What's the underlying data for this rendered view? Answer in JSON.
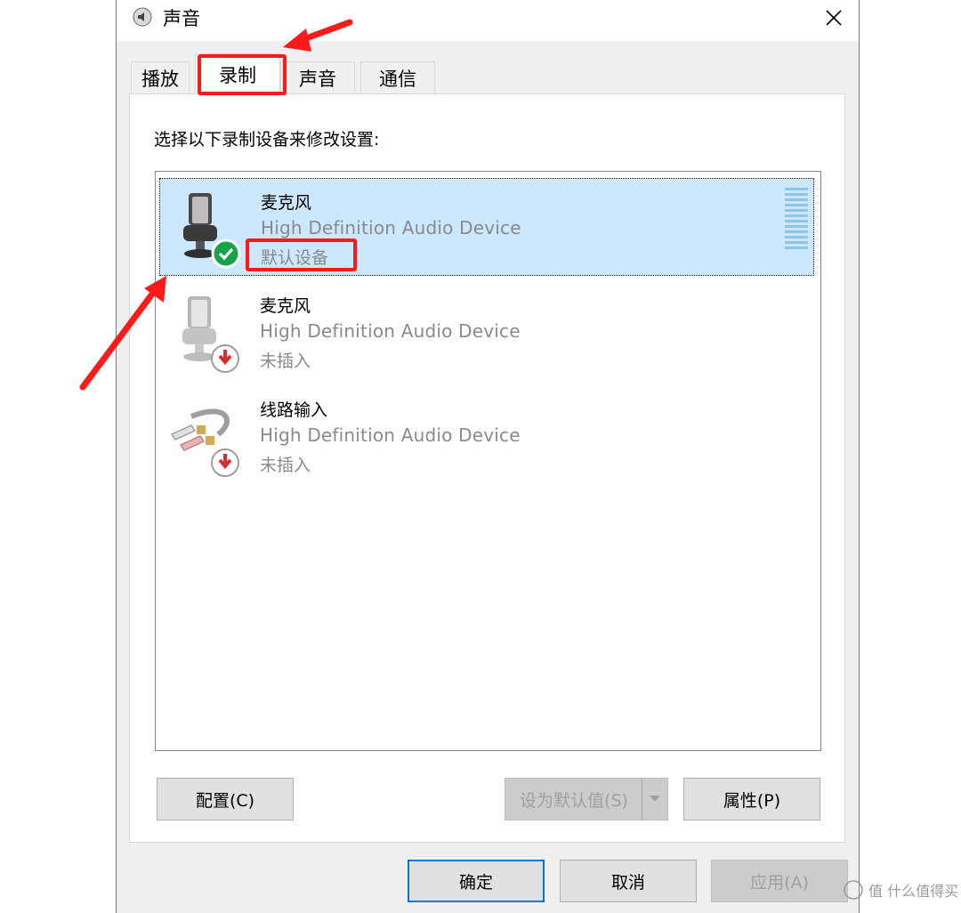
{
  "window": {
    "title": "声音"
  },
  "tabs": [
    {
      "label": "播放"
    },
    {
      "label": "录制"
    },
    {
      "label": "声音"
    },
    {
      "label": "通信"
    }
  ],
  "instruction": "选择以下录制设备来修改设置:",
  "devices": [
    {
      "name": "麦克风",
      "description": "High Definition Audio Device",
      "status": "默认设备",
      "icon": "microphone-icon",
      "badge": "default-check-icon"
    },
    {
      "name": "麦克风",
      "description": "High Definition Audio Device",
      "status": "未插入",
      "icon": "microphone-icon",
      "badge": "unplugged-arrow-icon"
    },
    {
      "name": "线路输入",
      "description": "High Definition Audio Device",
      "status": "未插入",
      "icon": "line-in-cable-icon",
      "badge": "unplugged-arrow-icon"
    }
  ],
  "buttons": {
    "configure": "配置(C)",
    "set_default": "设为默认值(S)",
    "properties": "属性(P)",
    "ok": "确定",
    "cancel": "取消",
    "apply": "应用(A)"
  },
  "watermark": "值 什么值得买",
  "colors": {
    "selection": "#cce8ff",
    "annotation": "#ff1a1a",
    "check": "#16a34a",
    "unplugged": "#d32f2f"
  }
}
